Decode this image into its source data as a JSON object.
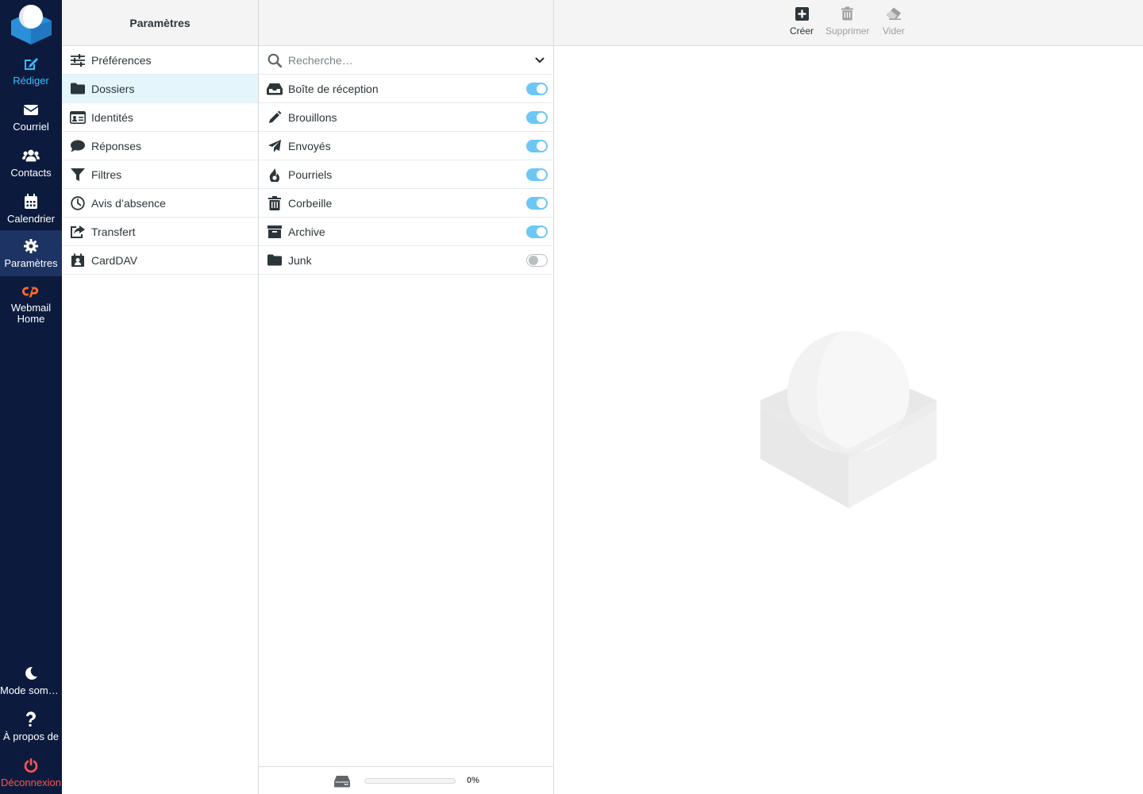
{
  "nav": {
    "compose": "Rédiger",
    "mail": "Courriel",
    "contacts": "Contacts",
    "calendar": "Calendrier",
    "settings": "Paramètres",
    "webmail_home_line1": "Webmail",
    "webmail_home_line2": "Home",
    "dark_mode": "Mode sombre",
    "about": "À propos de",
    "logout": "Déconnexion"
  },
  "settings_panel": {
    "title": "Paramètres",
    "items": [
      {
        "label": "Préférences",
        "icon": "sliders-icon"
      },
      {
        "label": "Dossiers",
        "icon": "folder-icon",
        "selected": true
      },
      {
        "label": "Identités",
        "icon": "id-card-icon"
      },
      {
        "label": "Réponses",
        "icon": "comment-icon"
      },
      {
        "label": "Filtres",
        "icon": "filter-icon"
      },
      {
        "label": "Avis d’absence",
        "icon": "clock-icon"
      },
      {
        "label": "Transfert",
        "icon": "share-icon"
      },
      {
        "label": "CardDAV",
        "icon": "address-book-icon"
      }
    ]
  },
  "folders_panel": {
    "search": {
      "placeholder": "Recherche…",
      "value": ""
    },
    "folders": [
      {
        "label": "Boîte de réception",
        "icon": "inbox-icon",
        "subscribed": true
      },
      {
        "label": "Brouillons",
        "icon": "pencil-icon",
        "subscribed": true
      },
      {
        "label": "Envoyés",
        "icon": "paper-plane-icon",
        "subscribed": true
      },
      {
        "label": "Pourriels",
        "icon": "fire-icon",
        "subscribed": true
      },
      {
        "label": "Corbeille",
        "icon": "trash-icon",
        "subscribed": true
      },
      {
        "label": "Archive",
        "icon": "archive-icon",
        "subscribed": true
      },
      {
        "label": "Junk",
        "icon": "folder-icon",
        "subscribed": false
      }
    ],
    "quota": {
      "percent_text": "0%",
      "percent": 0
    }
  },
  "toolbar": {
    "create": "Créer",
    "delete": "Supprimer",
    "empty": "Vider"
  },
  "colors": {
    "rail_bg": "#0c1b3d",
    "accent": "#37beff",
    "logout": "#ff5552",
    "selected_item_bg": "#e5f5fc"
  }
}
